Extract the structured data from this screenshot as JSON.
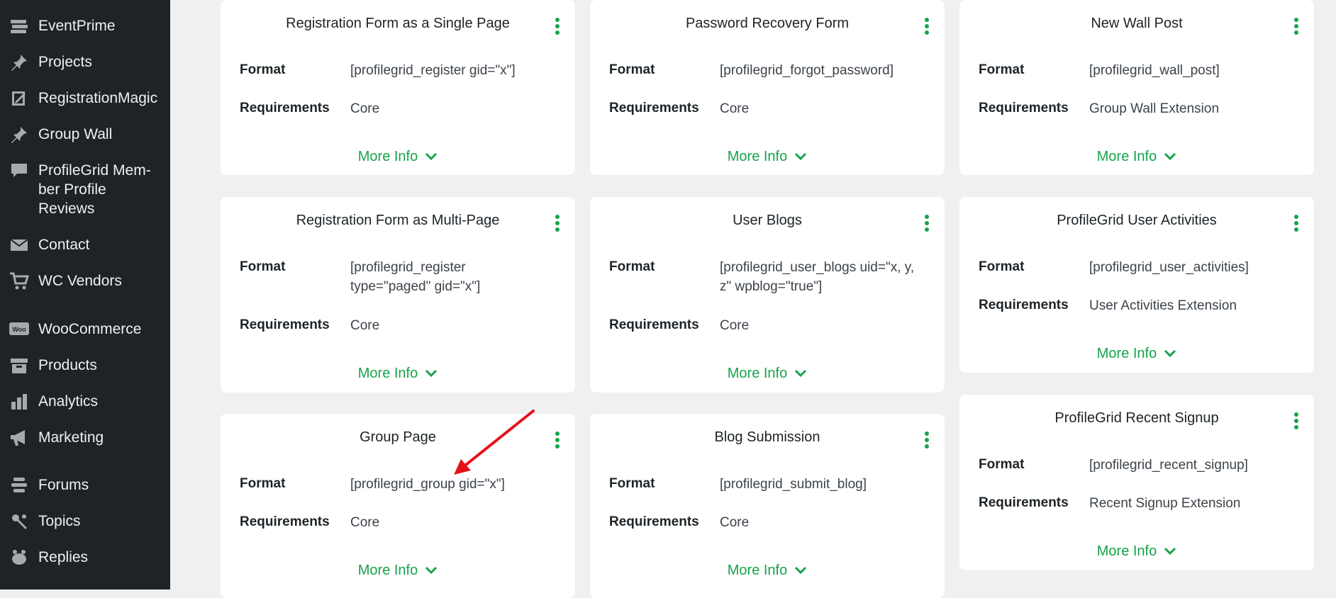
{
  "sidebar": {
    "items": [
      {
        "label": "EventPrime",
        "icon": "calendar-stack-icon"
      },
      {
        "label": "Projects",
        "icon": "pin-icon"
      },
      {
        "label": "RegistrationMagic",
        "icon": "form-icon"
      },
      {
        "label": "Group Wall",
        "icon": "pin-icon"
      },
      {
        "label": "ProfileGrid Mem-ber Profile Reviews",
        "icon": "comment-icon"
      },
      {
        "label": "Contact",
        "icon": "envelope-icon"
      },
      {
        "label": "WC Vendors",
        "icon": "cart-icon"
      },
      {
        "label": "WooCommerce",
        "icon": "woo-icon"
      },
      {
        "label": "Products",
        "icon": "archive-icon"
      },
      {
        "label": "Analytics",
        "icon": "bar-chart-icon"
      },
      {
        "label": "Marketing",
        "icon": "megaphone-icon"
      },
      {
        "label": "Forums",
        "icon": "forums-icon"
      },
      {
        "label": "Topics",
        "icon": "topics-icon"
      },
      {
        "label": "Replies",
        "icon": "replies-icon"
      }
    ]
  },
  "labels": {
    "format": "Format",
    "requirements": "Requirements",
    "more_info": "More Info"
  },
  "cards": [
    {
      "title": "Registration Form as a Single Page",
      "format": "[profilegrid_register gid=\"x\"]",
      "requirements": "Core"
    },
    {
      "title": "Password Recovery Form",
      "format": "[profilegrid_forgot_password]",
      "requirements": "Core"
    },
    {
      "title": "New Wall Post",
      "format": "[profilegrid_wall_post]",
      "requirements": "Group Wall Extension"
    },
    {
      "title": "Registration Form as Multi-Page",
      "format": "[profilegrid_register type=\"paged\" gid=\"x\"]",
      "requirements": "Core"
    },
    {
      "title": "User Blogs",
      "format": "[profilegrid_user_blogs uid=\"x, y, z\" wpblog=\"true\"]",
      "requirements": "Core"
    },
    {
      "title": "ProfileGrid User Activities",
      "format": "[profilegrid_user_activities]",
      "requirements": "User Activities Extension"
    },
    {
      "title": "Group Page",
      "format": "[profilegrid_group gid=\"x\"]",
      "requirements": "Core"
    },
    {
      "title": "Blog Submission",
      "format": "[profilegrid_submit_blog]",
      "requirements": "Core"
    },
    {
      "title": "ProfileGrid Recent Signup",
      "format": "[profilegrid_recent_signup]",
      "requirements": "Recent Signup Extension"
    }
  ],
  "colors": {
    "accent": "#16a34a",
    "sidebar_bg": "#1d2327",
    "page_bg": "#f0f0f1",
    "annotation_arrow": "#e3131b"
  }
}
